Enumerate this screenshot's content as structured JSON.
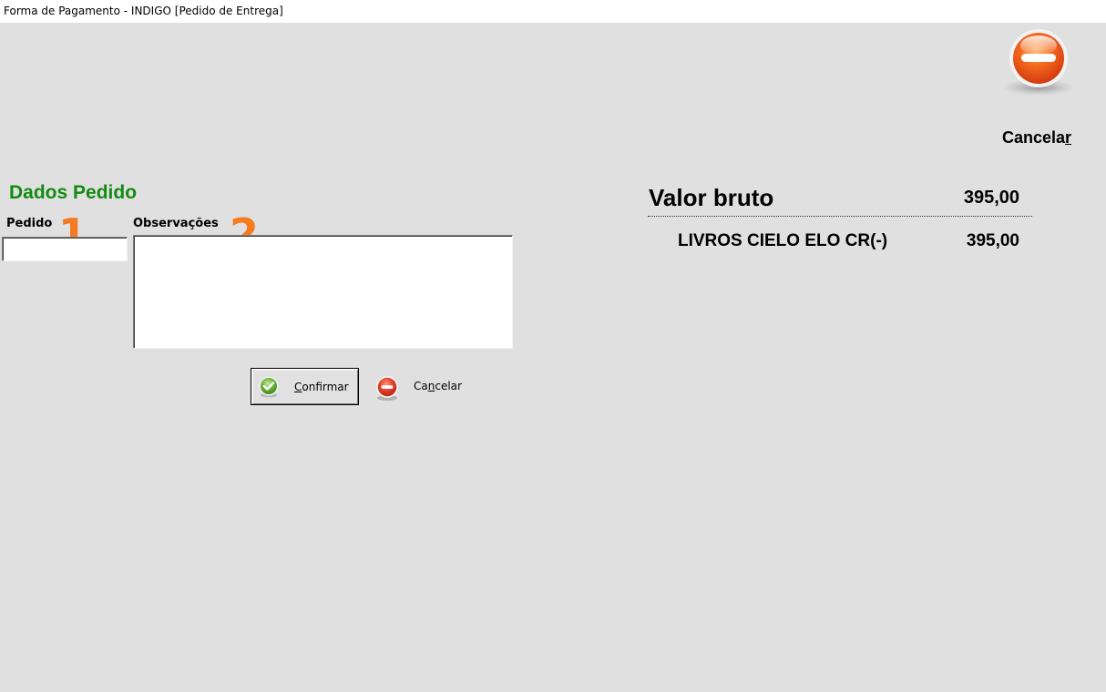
{
  "window": {
    "title": "Forma de Pagamento - INDIGO [Pedido de Entrega]"
  },
  "toolbar": {
    "cancel_label_main": "Cancela",
    "cancel_label_accel": "r",
    "cancel_icon": "minus-circle-icon"
  },
  "form": {
    "section_title": "Dados Pedido",
    "pedido_label": "Pedido",
    "pedido_value": "",
    "observacoes_label": "Observações",
    "observacoes_value": "",
    "annotation_1": "1",
    "annotation_2": "2"
  },
  "actions": {
    "confirm_accel": "C",
    "confirm_rest": "onfirmar",
    "confirm_icon": "check-circle-icon",
    "cancel_prefix": "Ca",
    "cancel_accel": "n",
    "cancel_rest": "celar",
    "cancel_icon": "minus-circle-icon"
  },
  "summary": {
    "total_label": "Valor bruto",
    "total_value": "395,00",
    "rows": [
      {
        "label": "LIVROS CIELO ELO CR(-)",
        "value": "395,00"
      }
    ]
  },
  "colors": {
    "background": "#e0e0e0",
    "section_title": "#138a13",
    "annotation": "#f47b1f",
    "cancel_red": "#e8401c",
    "confirm_green": "#5aa832"
  }
}
